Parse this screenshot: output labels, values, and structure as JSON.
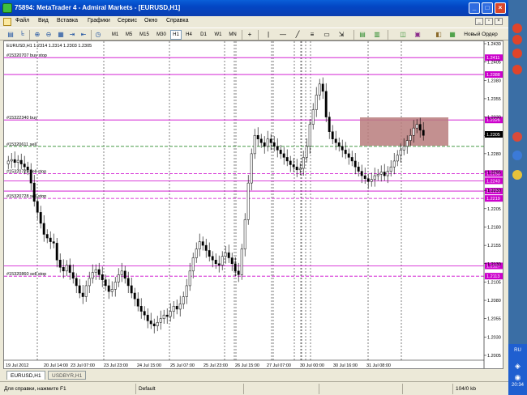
{
  "window": {
    "title": "75894: MetaTrader 4 - Admiral Markets - [EURUSD,H1]"
  },
  "menu": {
    "items": [
      "Файл",
      "Вид",
      "Вставка",
      "Графики",
      "Сервис",
      "Окно",
      "Справка"
    ]
  },
  "toolbar": {
    "timeframes": [
      "M1",
      "M5",
      "M15",
      "M30",
      "H1",
      "H4",
      "D1",
      "W1",
      "MN"
    ],
    "active_timeframe": "H1",
    "new_order_label": "Новый Ордер"
  },
  "chart": {
    "header": "EURUSD,H1  1.2314 1.2314 1.2303 1.2305",
    "current_price": "1.2305",
    "price_axis": [
      "1.2430",
      "1.2405",
      "1.2380",
      "1.2355",
      "1.2330",
      "1.2305",
      "1.2280",
      "1.2255",
      "1.2230",
      "1.2205",
      "1.2180",
      "1.2155",
      "1.2130",
      "1.2105",
      "1.2080",
      "1.2055",
      "1.2030",
      "1.2005"
    ],
    "date_axis": [
      "19 Jul 2012",
      "20 Jul 14:00",
      "23 Jul 07:00",
      "23 Jul 23:00",
      "24 Jul 15:00",
      "25 Jul 07:00",
      "25 Jul 23:00",
      "26 Jul 15:00",
      "27 Jul 07:00",
      "30 Jul 00:00",
      "30 Jul 16:00",
      "31 Jul 08:00"
    ],
    "orders": [
      {
        "label": "#15320707 buy stop",
        "price_tag": "1.2411"
      },
      {
        "label": "",
        "price_tag": "1.2388"
      },
      {
        "label": "#15322340 buy",
        "price_tag": "1.2326"
      },
      {
        "label": "#15320611 sell",
        "price_tag": ""
      },
      {
        "label": "#15320729 sell stop",
        "price_tag": "1.2253"
      },
      {
        "label": "",
        "price_tag": "1.2243"
      },
      {
        "label": "",
        "price_tag": "1.2229"
      },
      {
        "label": "#15320728 sell stop",
        "price_tag": "1.2219"
      },
      {
        "label": "",
        "price_tag": "1.2127"
      },
      {
        "label": "#15320860 sell stop",
        "price_tag": "1.2113"
      }
    ]
  },
  "tabs": [
    {
      "label": "EURUSD,H1"
    },
    {
      "label": "USDBYR,H1"
    }
  ],
  "status": {
    "help": "Для справки, нажмите F1",
    "profile": "Default",
    "traffic": "104/0 kb"
  },
  "tray": {
    "lang": "RU",
    "time": "20:34"
  }
}
